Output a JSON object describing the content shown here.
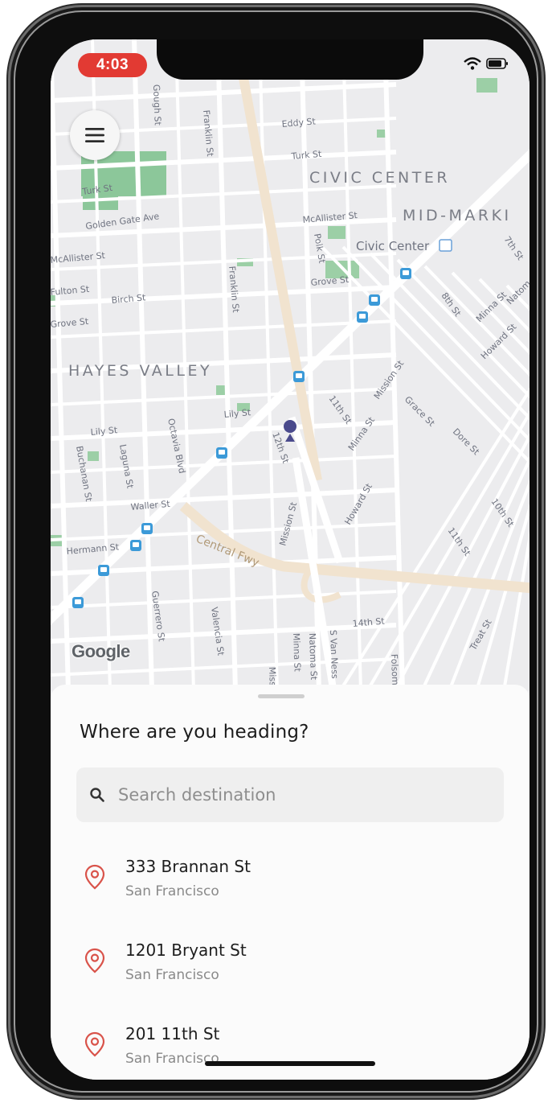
{
  "status_bar": {
    "time": "4:03"
  },
  "map": {
    "attribution": "Google",
    "districts": [
      "CIVIC CENTER",
      "MID-MARKI",
      "HAYES VALLEY"
    ],
    "streets": [
      "Eddy St",
      "Turk St",
      "Turk St",
      "Golden Gate Ave",
      "McAllister St",
      "McAllister St",
      "Fulton St",
      "Grove St",
      "Grove St",
      "Birch St",
      "Lily St",
      "Lily St",
      "Waller St",
      "Hermann St",
      "12th St",
      "11th St",
      "10th St",
      "11th St",
      "14th St",
      "Mission St",
      "Mission St",
      "Mission St",
      "Minna St",
      "Minna St",
      "Natoma St",
      "Howard St",
      "Howard St",
      "Grace St",
      "Dore St",
      "Treat St",
      "Gough St",
      "Franklin St",
      "Franklin St",
      "Polk St",
      "Octavia Blvd",
      "Laguna St",
      "Buchanan St",
      "Guerrero St",
      "Valencia St",
      "S Van Ness",
      "Folsom",
      "Central Fwy",
      "7th St",
      "8th St",
      "Natom",
      "Minna St"
    ],
    "poi": "Civic Center"
  },
  "sheet": {
    "title": "Where are you heading?",
    "search_placeholder": "Search destination",
    "destinations": [
      {
        "name": "333 Brannan St",
        "city": "San Francisco"
      },
      {
        "name": "1201 Bryant St",
        "city": "San Francisco"
      },
      {
        "name": "201 11th St",
        "city": "San Francisco"
      }
    ]
  },
  "colors": {
    "accent": "#e23a33",
    "pin": "#d9534a",
    "user_dot": "#4a4a8c",
    "map_bg": "#efeff1"
  }
}
